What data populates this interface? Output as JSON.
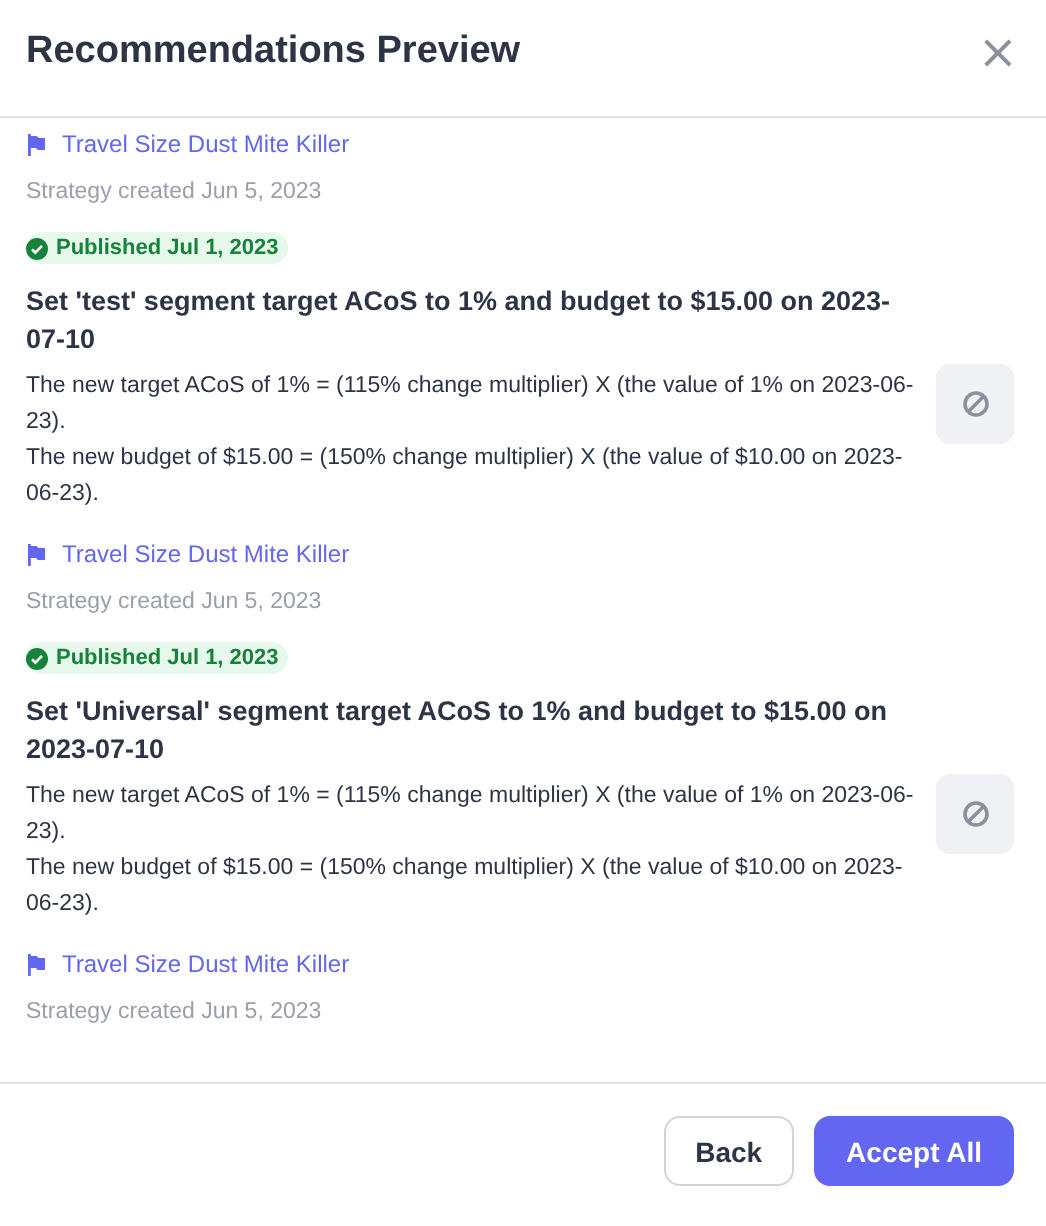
{
  "dialog": {
    "title": "Recommendations Preview",
    "close": "×"
  },
  "entries": [
    {
      "product": "Travel Size Dust Mite Killer",
      "created": "Strategy created Jun 5, 2023"
    },
    {
      "badge": {
        "text": "Published Jul 1, 2023",
        "kind": "success"
      },
      "title": "Set 'test' segment target ACoS to 1% and budget to $15.00 on 2023-07-10",
      "lines": [
        "The new target ACoS of 1% = (115% change multiplier) X (the value of 1% on 2023-06-23).",
        "The new budget of $15.00 = (150% change multiplier) X (the value of $10.00 on 2023-06-23)."
      ],
      "ignore_button": true,
      "product": "Travel Size Dust Mite Killer",
      "created": "Strategy created Jun 5, 2023"
    },
    {
      "badge": {
        "text": "Published Jul 1, 2023",
        "kind": "success"
      },
      "title": "Set 'Universal' segment target ACoS to 1% and budget to $15.00 on 2023-07-10",
      "lines": [
        "The new target ACoS of 1% = (115% change multiplier) X (the value of 1% on 2023-06-23).",
        "The new budget of $15.00 = (150% change multiplier) X (the value of $10.00 on 2023-06-23)."
      ],
      "ignore_button": true,
      "product": "Travel Size Dust Mite Killer",
      "created": "Strategy created Jun 5, 2023"
    }
  ],
  "footer": {
    "buttons": [
      {
        "label": "Back",
        "kind": "secondary"
      },
      {
        "label": "Accept All",
        "kind": "primary"
      }
    ]
  }
}
